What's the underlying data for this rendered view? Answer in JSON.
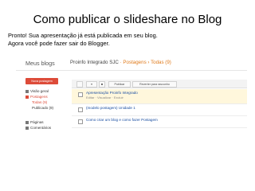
{
  "slide": {
    "title": "Como publicar o slideshare no Blog",
    "caption_line1": "Pronto! Sua apresentação já está publicada em seu blog.",
    "caption_line2": "Agora você pode fazer sair do Blogger."
  },
  "blogger": {
    "my_blogs": "Meus blogs",
    "blog_name": "Proinfo Integrado SJC",
    "crumb_sep1": "·",
    "crumb_section": "Postagens",
    "crumb_sep2": "›",
    "crumb_filter": "Todas (9)",
    "new_post": "Nova postagem",
    "nav": {
      "overview": "Visão geral",
      "posts": "Postagens",
      "all": "Todas (9)",
      "published": "Publicado (9)",
      "pages": "Páginas",
      "comments": "Comentários"
    },
    "toolbar": {
      "publish": "Publicar",
      "revert": "Reverter para rascunho"
    },
    "posts": [
      {
        "title": "Apresentação Proinfo Integrado",
        "actions": "Editar · Visualizar · Excluir"
      },
      {
        "title": "(modelo postagem) Unidade 1",
        "actions": ""
      },
      {
        "title": "Como criar um blog e como fazer Postagem",
        "actions": ""
      }
    ],
    "colors": {
      "new_button": "#dd4b39",
      "accent_orange": "#e07a1a",
      "highlight_row": "#fff7dc",
      "link_blue": "#1a4ea1"
    }
  }
}
